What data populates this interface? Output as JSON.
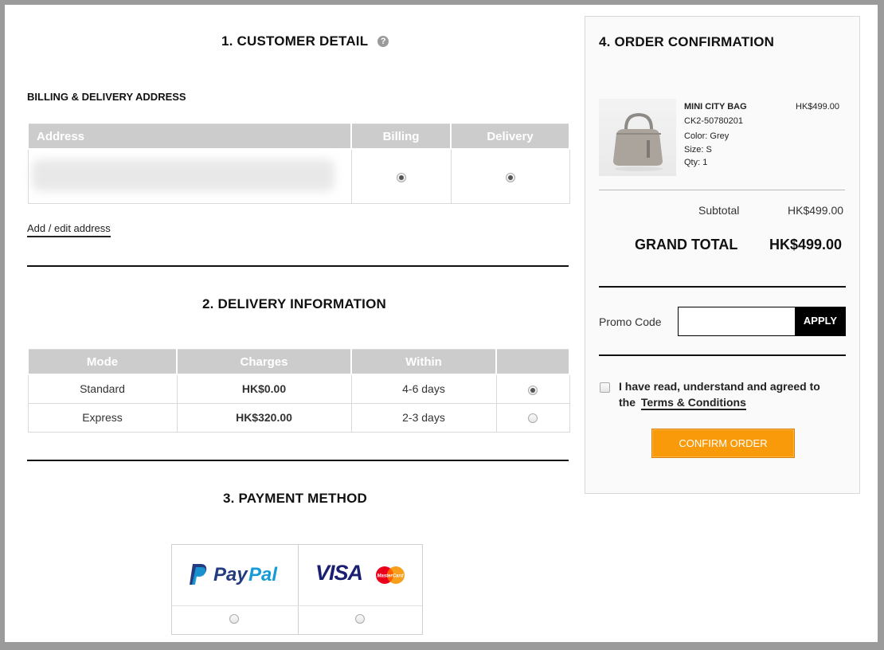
{
  "customer": {
    "title": "1. CUSTOMER DETAIL",
    "help_icon": "?",
    "subtitle": "BILLING & DELIVERY ADDRESS",
    "columns": [
      "Address",
      "Billing",
      "Delivery"
    ],
    "add_edit_link": "Add / edit address"
  },
  "delivery": {
    "title": "2. DELIVERY INFORMATION",
    "columns": [
      "Mode",
      "Charges",
      "Within",
      ""
    ],
    "rows": [
      {
        "mode": "Standard",
        "charge": "HK$0.00",
        "within": "4-6 days",
        "selected": true
      },
      {
        "mode": "Express",
        "charge": "HK$320.00",
        "within": "2-3 days",
        "selected": false
      }
    ]
  },
  "payment": {
    "title": "3. PAYMENT METHOD",
    "options": [
      {
        "name": "PayPal",
        "logo_a": "Pay",
        "logo_b": "Pal"
      },
      {
        "name": "VISA",
        "logo_text": "VISA",
        "mc_text": "MasterCard"
      }
    ]
  },
  "order": {
    "title": "4. ORDER CONFIRMATION",
    "item": {
      "name": "MINI CITY BAG",
      "sku": "CK2-50780201",
      "color": "Color: Grey",
      "size": "Size: S",
      "qty": "Qty: 1",
      "price": "HK$499.00"
    },
    "subtotal_label": "Subtotal",
    "subtotal_value": "HK$499.00",
    "grand_total_label": "GRAND TOTAL",
    "grand_total_value": "HK$499.00",
    "promo_label": "Promo Code",
    "promo_placeholder": "",
    "apply_label": "APPLY",
    "terms_text": "I have read, understand and agreed to",
    "terms_the": "the",
    "terms_link": "Terms & Conditions",
    "confirm_label": "CONFIRM ORDER"
  },
  "colors": {
    "accent": "#f99a0a",
    "header_gray": "#cccccc",
    "paypal_dark": "#253b80",
    "paypal_light": "#179bd7",
    "visa_blue": "#1a1f71"
  },
  "icons": {
    "help": "help-icon",
    "bag": "bag-image",
    "paypal": "paypal-logo",
    "visa": "visa-logo",
    "mastercard": "mastercard-logo"
  }
}
